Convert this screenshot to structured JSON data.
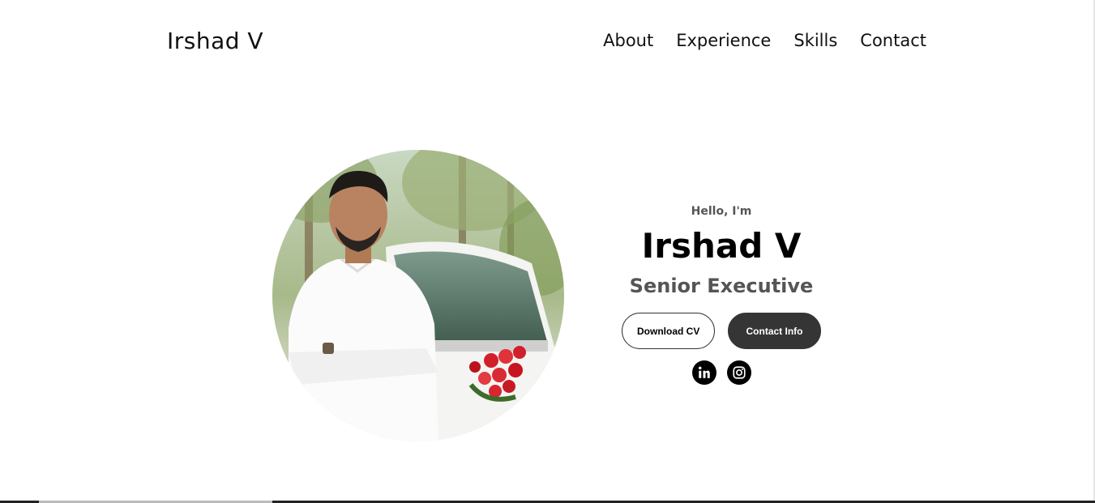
{
  "nav": {
    "logo": "Irshad V",
    "links": [
      "About",
      "Experience",
      "Skills",
      "Contact"
    ]
  },
  "hero": {
    "greeting": "Hello, I'm",
    "name": "Irshad V",
    "role": "Senior Executive",
    "buttons": {
      "download_cv": "Download CV",
      "contact_info": "Contact Info"
    },
    "socials": [
      "linkedin-icon",
      "instagram-icon"
    ]
  },
  "colors": {
    "text": "#000000",
    "muted": "#555555",
    "button_dark": "#353535",
    "background": "#ffffff"
  }
}
